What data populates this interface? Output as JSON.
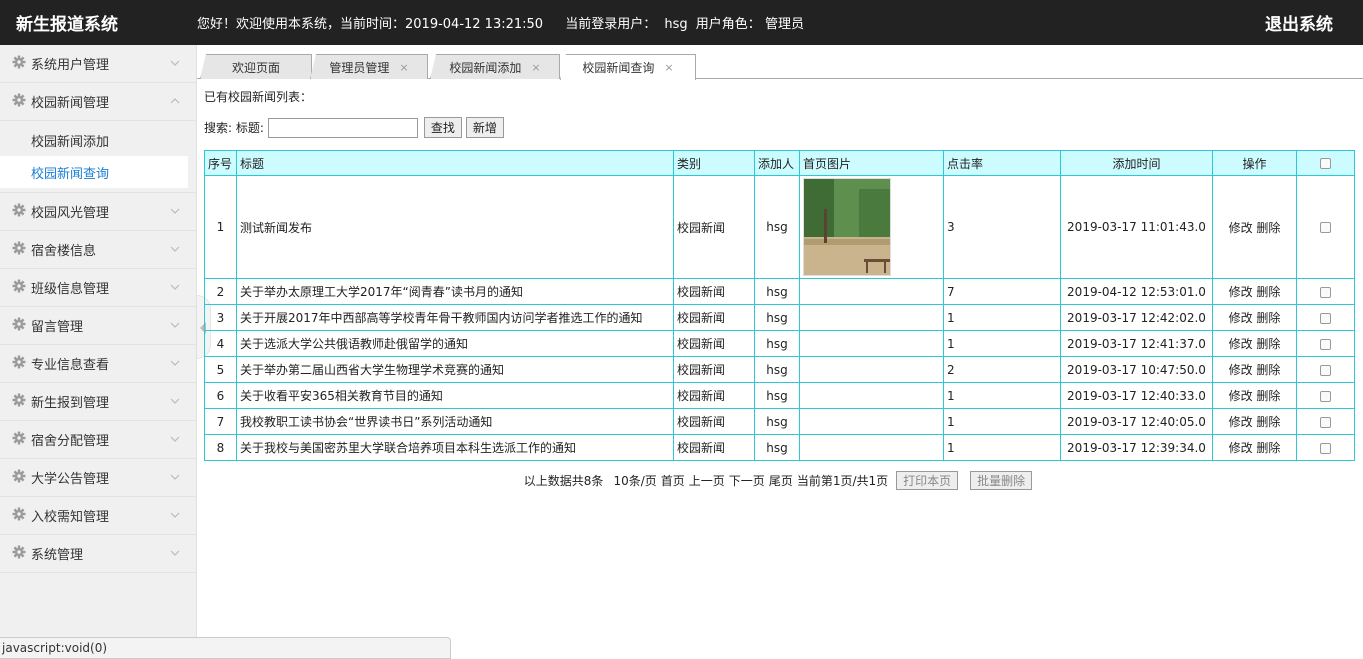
{
  "app": {
    "brand": "新生报道系统",
    "welcome": "您好！欢迎使用本系统，当前时间：2019-04-12 13:21:50",
    "user_label": "当前登录用户：",
    "user_name": "hsg",
    "role_label": "用户角色：",
    "role_name": "管理员",
    "logout": "退出系统"
  },
  "sidebar": {
    "groups": [
      {
        "label": "系统用户管理",
        "expanded": false
      },
      {
        "label": "校园新闻管理",
        "expanded": true,
        "items": [
          {
            "label": "校园新闻添加",
            "active": false
          },
          {
            "label": "校园新闻查询",
            "active": true
          }
        ]
      },
      {
        "label": "校园风光管理",
        "expanded": false
      },
      {
        "label": "宿舍楼信息",
        "expanded": false
      },
      {
        "label": "班级信息管理",
        "expanded": false
      },
      {
        "label": "留言管理",
        "expanded": false
      },
      {
        "label": "专业信息查看",
        "expanded": false
      },
      {
        "label": "新生报到管理",
        "expanded": false
      },
      {
        "label": "宿舍分配管理",
        "expanded": false
      },
      {
        "label": "大学公告管理",
        "expanded": false
      },
      {
        "label": "入校需知管理",
        "expanded": false
      },
      {
        "label": "系统管理",
        "expanded": false
      }
    ]
  },
  "tabs": [
    {
      "label": "欢迎页面",
      "closable": false,
      "active": false
    },
    {
      "label": "管理员管理",
      "closable": true,
      "active": false
    },
    {
      "label": "校园新闻添加",
      "closable": true,
      "active": false
    },
    {
      "label": "校园新闻查询",
      "closable": true,
      "active": true
    }
  ],
  "tab_close_glyph": "×",
  "page": {
    "caption": "已有校园新闻列表：",
    "search_label": "搜索: 标题:",
    "search_value": "",
    "search_button": "查找",
    "add_button": "新增"
  },
  "table": {
    "headers": [
      "序号",
      "标题",
      "类别",
      "添加人",
      "首页图片",
      "点击率",
      "添加时间",
      "操作"
    ],
    "edit_label": "修改",
    "delete_label": "删除",
    "rows": [
      {
        "no": "1",
        "title": "测试新闻发布",
        "category": "校园新闻",
        "author": "hsg",
        "has_image": true,
        "clicks": "3",
        "time": "2019-03-17 11:01:43.0"
      },
      {
        "no": "2",
        "title": "关于举办太原理工大学2017年“阅青春”读书月的通知",
        "category": "校园新闻",
        "author": "hsg",
        "has_image": false,
        "clicks": "7",
        "time": "2019-04-12 12:53:01.0"
      },
      {
        "no": "3",
        "title": "关于开展2017年中西部高等学校青年骨干教师国内访问学者推选工作的通知",
        "category": "校园新闻",
        "author": "hsg",
        "has_image": false,
        "clicks": "1",
        "time": "2019-03-17 12:42:02.0"
      },
      {
        "no": "4",
        "title": "关于选派大学公共俄语教师赴俄留学的通知",
        "category": "校园新闻",
        "author": "hsg",
        "has_image": false,
        "clicks": "1",
        "time": "2019-03-17 12:41:37.0"
      },
      {
        "no": "5",
        "title": "关于举办第二届山西省大学生物理学术竞赛的通知",
        "category": "校园新闻",
        "author": "hsg",
        "has_image": false,
        "clicks": "2",
        "time": "2019-03-17 10:47:50.0"
      },
      {
        "no": "6",
        "title": "关于收看平安365相关教育节目的通知",
        "category": "校园新闻",
        "author": "hsg",
        "has_image": false,
        "clicks": "1",
        "time": "2019-03-17 12:40:33.0"
      },
      {
        "no": "7",
        "title": "我校教职工读书协会“世界读书日”系列活动通知",
        "category": "校园新闻",
        "author": "hsg",
        "has_image": false,
        "clicks": "1",
        "time": "2019-03-17 12:40:05.0"
      },
      {
        "no": "8",
        "title": "关于我校与美国密苏里大学联合培养项目本科生选派工作的通知",
        "category": "校园新闻",
        "author": "hsg",
        "has_image": false,
        "clicks": "1",
        "time": "2019-03-17 12:39:34.0"
      }
    ]
  },
  "pager": {
    "summary": "以上数据共8条",
    "per_page": "10条/页",
    "first": "首页",
    "prev": "上一页",
    "next": "下一页",
    "last": "尾页",
    "current": "当前第1页/共1页",
    "print_button": "打印本页",
    "batch_delete_button": "批量删除"
  },
  "statusbar": "javascript:void(0)"
}
